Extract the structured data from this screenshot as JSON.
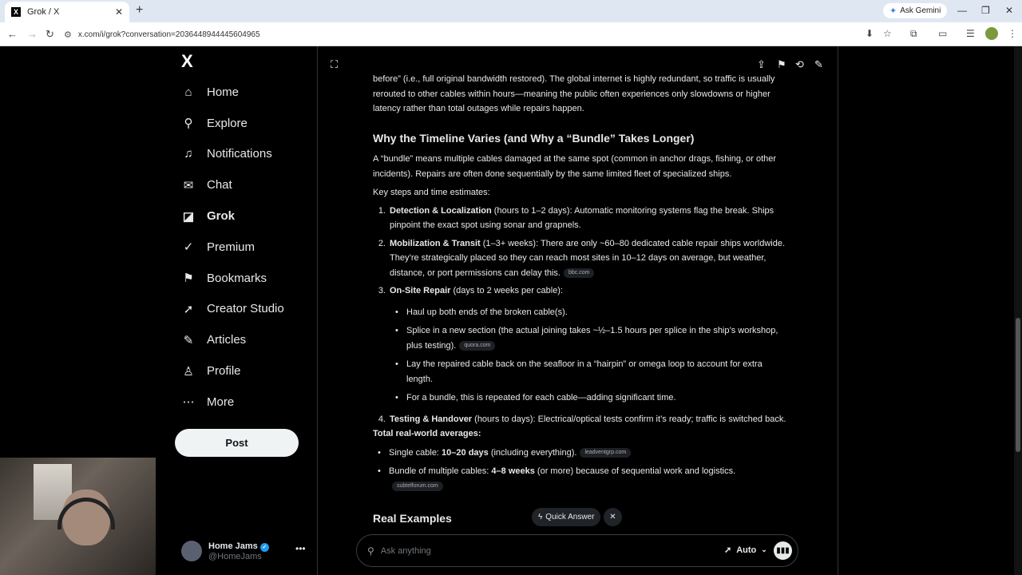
{
  "browser": {
    "tab_title": "Grok / X",
    "tab_favicon": "X",
    "new_tab": "+",
    "ask_gemini": "Ask Gemini",
    "url": "x.com/i/grok?conversation=2036448944445604965"
  },
  "sidebar": {
    "logo": "X",
    "items": [
      {
        "label": "Home",
        "icon": "home-icon",
        "glyph": "⌂"
      },
      {
        "label": "Explore",
        "icon": "search-icon",
        "glyph": "⚲"
      },
      {
        "label": "Notifications",
        "icon": "bell-icon",
        "glyph": "♫"
      },
      {
        "label": "Chat",
        "icon": "mail-icon",
        "glyph": "✉"
      },
      {
        "label": "Grok",
        "icon": "grok-icon",
        "glyph": "◪"
      },
      {
        "label": "Premium",
        "icon": "premium-icon",
        "glyph": "✓"
      },
      {
        "label": "Bookmarks",
        "icon": "bookmark-icon",
        "glyph": "⚑"
      },
      {
        "label": "Creator Studio",
        "icon": "rocket-icon",
        "glyph": "➚"
      },
      {
        "label": "Articles",
        "icon": "articles-icon",
        "glyph": "✎"
      },
      {
        "label": "Profile",
        "icon": "profile-icon",
        "glyph": "♙"
      },
      {
        "label": "More",
        "icon": "more-icon",
        "glyph": "⋯"
      }
    ],
    "post_label": "Post",
    "account": {
      "name": "Home Jams",
      "handle": "@HomeJams"
    }
  },
  "content": {
    "intro": "before” (i.e., full original bandwidth restored). The global internet is highly redundant, so traffic is usually rerouted to other cables within hours—meaning the public often experiences only slowdowns or higher latency rather than total outages while repairs happen.",
    "heading1": "Why the Timeline Varies (and Why a “Bundle” Takes Longer)",
    "bundle_para": "A “bundle” means multiple cables damaged at the same spot (common in anchor drags, fishing, or other incidents). Repairs are often done sequentially by the same limited fleet of specialized ships.",
    "key_steps": "Key steps and time estimates:",
    "steps": [
      {
        "num": "1.",
        "title": "Detection & Localization",
        "text": " (hours to 1–2 days): Automatic monitoring systems flag the break. Ships pinpoint the exact spot using sonar and grapnels.",
        "cite": ""
      },
      {
        "num": "2.",
        "title": "Mobilization & Transit",
        "text": " (1–3+ weeks): There are only ~60–80 dedicated cable repair ships worldwide. They’re strategically placed so they can reach most sites in 10–12 days on average, but weather, distance, or port permissions can delay this.",
        "cite": "bbc.com"
      },
      {
        "num": "3.",
        "title": "On-Site Repair",
        "text": " (days to 2 weeks per cable):",
        "cite": ""
      }
    ],
    "repair_bullets": [
      {
        "text": "Haul up both ends of the broken cable(s).",
        "cite": ""
      },
      {
        "text": "Splice in a new section (the actual joining takes ~½–1.5 hours per splice in the ship’s workshop, plus testing).",
        "cite": "quora.com"
      },
      {
        "text": "Lay the repaired cable back on the seafloor in a “hairpin” or omega loop to account for extra length.",
        "cite": ""
      },
      {
        "text": "For a bundle, this is repeated for each cable—adding significant time.",
        "cite": ""
      }
    ],
    "step4": {
      "num": "4.",
      "title": "Testing & Handover",
      "text": " (hours to days): Electrical/optical tests confirm it’s ready; traffic is switched back."
    },
    "totals_heading": "Total real-world averages:",
    "totals": [
      {
        "prefix": "Single cable: ",
        "bold": "10–20 days",
        "suffix": " (including everything).",
        "cite": "leadventgrp.com"
      },
      {
        "prefix": "Bundle of multiple cables: ",
        "bold": "4–8 weeks",
        "suffix": " (or more) because of sequential work and logistics.",
        "cite": "subtelforum.com"
      }
    ],
    "heading2": "Real Examples"
  },
  "chat": {
    "quick_answer": "Quick Answer",
    "placeholder": "Ask anything",
    "mode": "Auto"
  }
}
